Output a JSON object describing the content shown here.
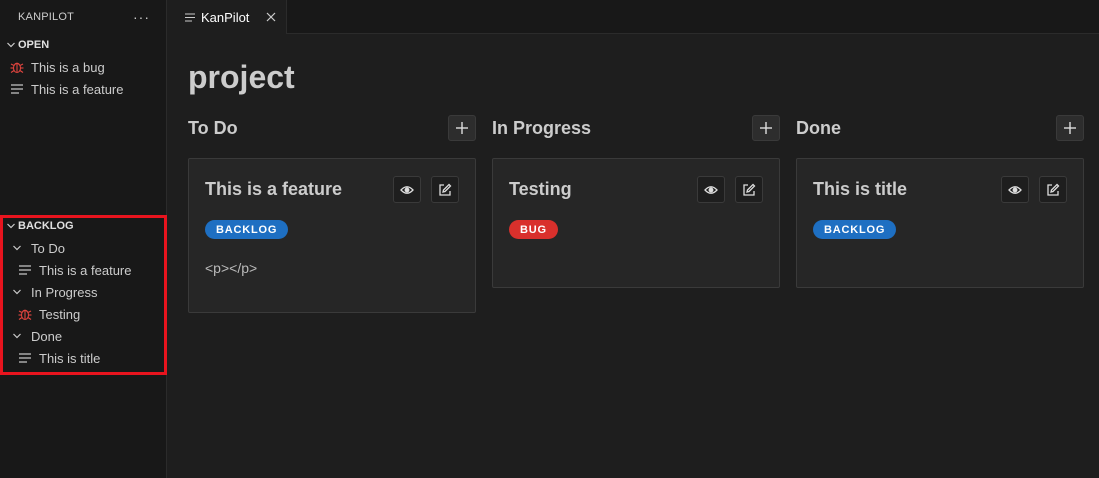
{
  "sidebar": {
    "title": "KANPILOT",
    "more_label": "···",
    "open": {
      "label": "OPEN",
      "items": [
        {
          "label": "This is a bug",
          "icon": "bug-icon"
        },
        {
          "label": "This is a feature",
          "icon": "feature-lines-icon"
        }
      ]
    },
    "backlog": {
      "label": "BACKLOG",
      "groups": [
        {
          "label": "To Do",
          "items": [
            {
              "label": "This is a feature",
              "icon": "feature-lines-icon"
            }
          ]
        },
        {
          "label": "In Progress",
          "items": [
            {
              "label": "Testing",
              "icon": "bug-icon"
            }
          ]
        },
        {
          "label": "Done",
          "items": [
            {
              "label": "This is title",
              "icon": "feature-lines-icon"
            }
          ]
        }
      ]
    }
  },
  "tab": {
    "label": "KanPilot"
  },
  "main": {
    "title": "project",
    "columns": [
      {
        "title": "To Do",
        "card": {
          "title": "This is a feature",
          "badge": "BACKLOG",
          "badge_color": "#1e6fc2",
          "body": "<p></p>"
        }
      },
      {
        "title": "In Progress",
        "card": {
          "title": "Testing",
          "badge": "BUG",
          "badge_color": "#d9302c",
          "body": ""
        }
      },
      {
        "title": "Done",
        "card": {
          "title": "This is title",
          "badge": "BACKLOG",
          "badge_color": "#1e6fc2",
          "body": ""
        }
      }
    ]
  },
  "colors": {
    "bug_icon": "#e0443e",
    "highlight": "#e8141e"
  }
}
